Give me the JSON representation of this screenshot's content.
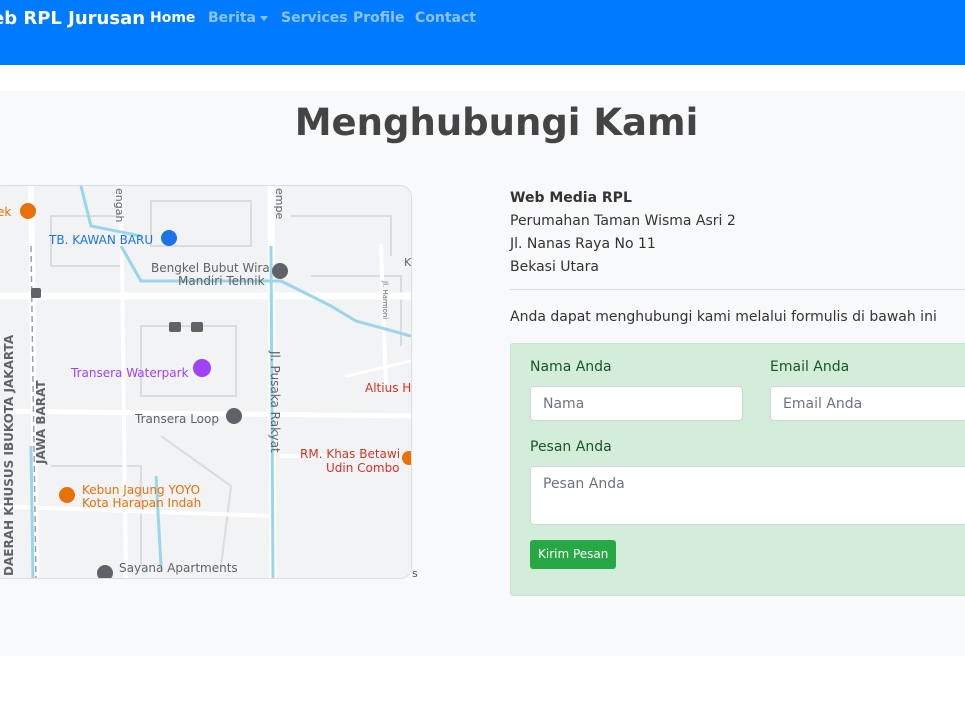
{
  "navbar": {
    "brand": "eb RPL Jurusan",
    "items": [
      {
        "label": "Home",
        "active": true
      },
      {
        "label": "Berita",
        "dropdown": true
      },
      {
        "label": "Services"
      },
      {
        "label": "Profile"
      },
      {
        "label": "Contact"
      }
    ]
  },
  "page": {
    "title": "Menghubungi Kami"
  },
  "map": {
    "places": [
      {
        "label": "ek"
      },
      {
        "label": "TB. KAWAN BARU"
      },
      {
        "label": "Bengkel Bubut Wira"
      },
      {
        "label": "Mandiri Tehnik"
      },
      {
        "label": "Transera Waterpark"
      },
      {
        "label": "Transera Loop"
      },
      {
        "label": "Altius H"
      },
      {
        "label": "RM. Khas Betawi"
      },
      {
        "label": "Udin Combo"
      },
      {
        "label": "Kebun Jagung YOYO"
      },
      {
        "label": "Kota Harapan Indah"
      },
      {
        "label": "Sayana Apartments"
      }
    ],
    "roads": [
      {
        "label": "engah"
      },
      {
        "label": "empe"
      },
      {
        "label": "Jl. Pusaka Rakyat"
      },
      {
        "label": "JAWA BARAT"
      },
      {
        "label": "DAERAH KHUSUS IBUKOTA JAKARTA"
      },
      {
        "label": "Jl. Harmoni"
      },
      {
        "label": "K"
      }
    ],
    "corner_label": "s",
    "colors": {
      "road": "#ffffff",
      "water": "#9ad6ea",
      "bg": "#f1f3f4",
      "orange": "#e8710a",
      "purple": "#a142f4",
      "blue": "#1a73e8",
      "red": "#d93025",
      "gray": "#5f6368"
    }
  },
  "contact": {
    "org": "Web Media RPL",
    "address_line1": "Perumahan Taman Wisma Asri 2",
    "address_line2": "Jl. Nanas Raya No 11",
    "address_line3": "Bekasi Utara",
    "intro": "Anda dapat menghubungi kami melalui formulis di bawah ini"
  },
  "form": {
    "name_label": "Nama Anda",
    "name_placeholder": "Nama",
    "email_label": "Email Anda",
    "email_placeholder": "Email Anda",
    "message_label": "Pesan Anda",
    "message_placeholder": "Pesan Anda",
    "submit_label": "Kirim Pesan"
  }
}
